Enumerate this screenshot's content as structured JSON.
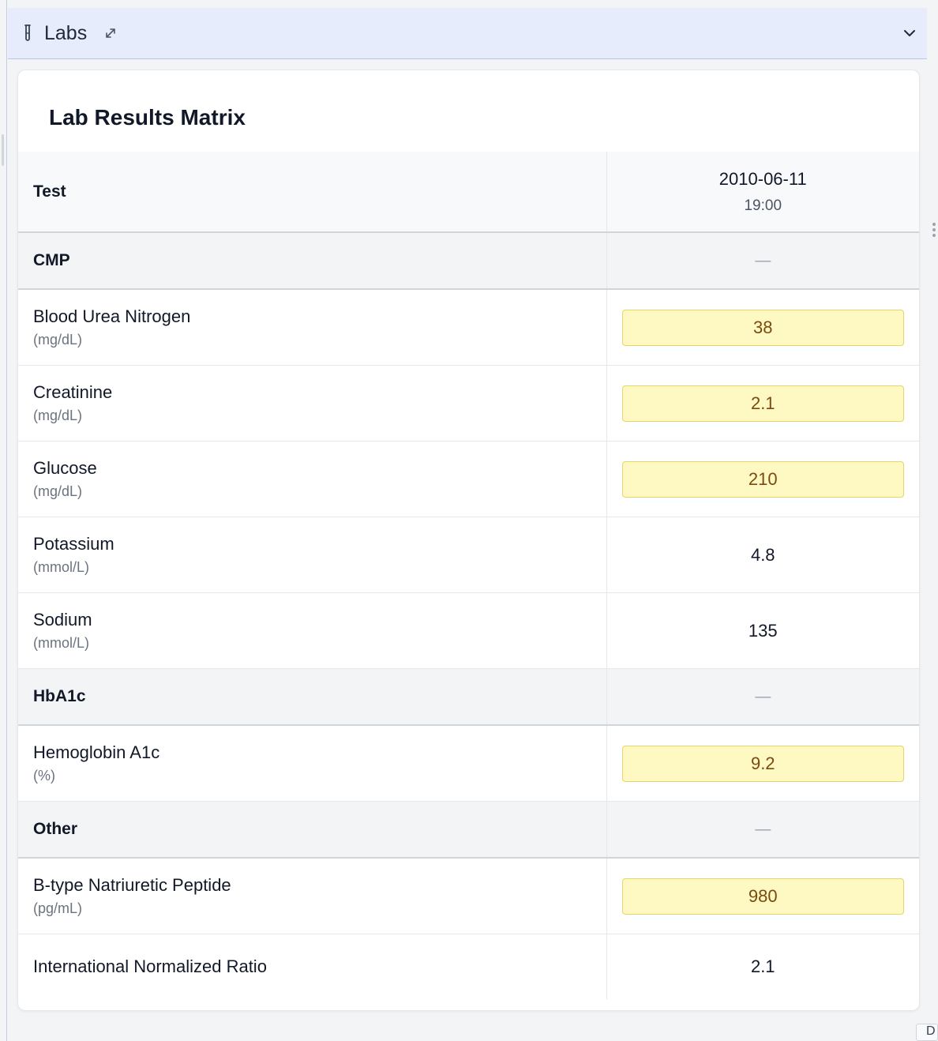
{
  "panel": {
    "title": "Labs",
    "icons": {
      "type_icon": "test-tube-icon",
      "expand_icon": "expand-arrows-icon",
      "collapse_icon": "chevron-down-icon"
    }
  },
  "card": {
    "title": "Lab Results Matrix"
  },
  "table": {
    "test_header": "Test",
    "date": "2010-06-11",
    "time": "19:00",
    "groups": [
      {
        "name": "CMP",
        "summary": "—",
        "rows": [
          {
            "name": "Blood Urea Nitrogen",
            "unit": "(mg/dL)",
            "value": "38",
            "flagged": true
          },
          {
            "name": "Creatinine",
            "unit": "(mg/dL)",
            "value": "2.1",
            "flagged": true
          },
          {
            "name": "Glucose",
            "unit": "(mg/dL)",
            "value": "210",
            "flagged": true
          },
          {
            "name": "Potassium",
            "unit": "(mmol/L)",
            "value": "4.8",
            "flagged": false
          },
          {
            "name": "Sodium",
            "unit": "(mmol/L)",
            "value": "135",
            "flagged": false
          }
        ]
      },
      {
        "name": "HbA1c",
        "summary": "—",
        "rows": [
          {
            "name": "Hemoglobin A1c",
            "unit": "(%)",
            "value": "9.2",
            "flagged": true
          }
        ]
      },
      {
        "name": "Other",
        "summary": "—",
        "rows": [
          {
            "name": "B-type Natriuretic Peptide",
            "unit": "(pg/mL)",
            "value": "980",
            "flagged": true
          },
          {
            "name": "International Normalized Ratio",
            "unit": "",
            "value": "2.1",
            "flagged": false
          }
        ]
      }
    ]
  },
  "colors": {
    "header_bg": "#e6ecfb",
    "flag_bg": "#fef9c3",
    "flag_text": "#7a4a0e"
  }
}
